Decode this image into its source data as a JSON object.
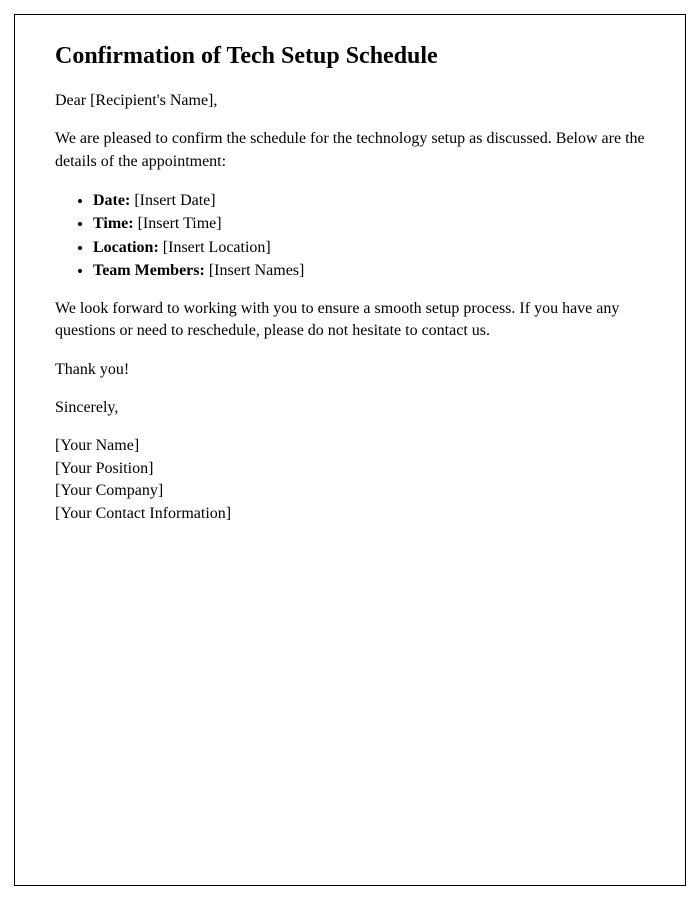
{
  "title": "Confirmation of Tech Setup Schedule",
  "salutation": "Dear [Recipient's Name],",
  "intro": "We are pleased to confirm the schedule for the technology setup as discussed. Below are the details of the appointment:",
  "details": [
    {
      "label": "Date:",
      "value": "[Insert Date]"
    },
    {
      "label": "Time:",
      "value": "[Insert Time]"
    },
    {
      "label": "Location:",
      "value": "[Insert Location]"
    },
    {
      "label": "Team Members:",
      "value": "[Insert Names]"
    }
  ],
  "body": "We look forward to working with you to ensure a smooth setup process. If you have any questions or need to reschedule, please do not hesitate to contact us.",
  "thanks": "Thank you!",
  "closing": "Sincerely,",
  "signature": {
    "name": "[Your Name]",
    "position": "[Your Position]",
    "company": "[Your Company]",
    "contact": "[Your Contact Information]"
  }
}
